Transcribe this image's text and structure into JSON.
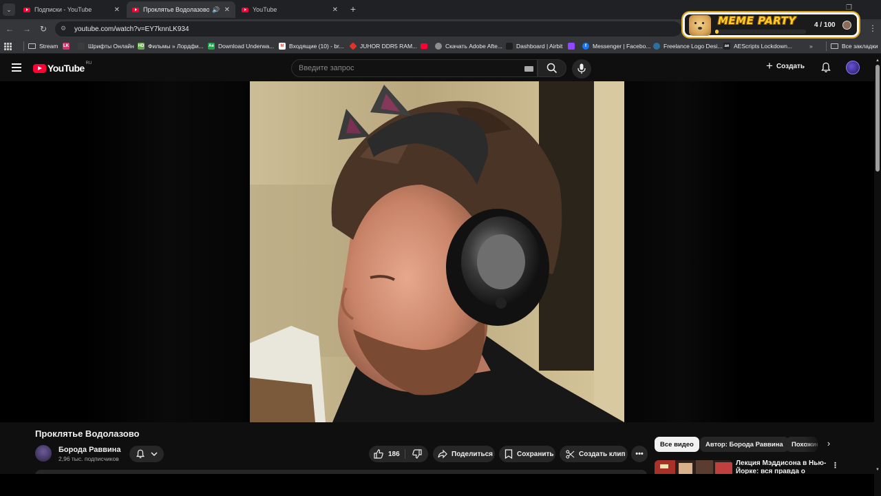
{
  "browser": {
    "tabs": [
      {
        "title": "Подписки - YouTube",
        "active": false
      },
      {
        "title": "Проклятье Водолазово - YouTube",
        "active": true
      },
      {
        "title": "YouTube",
        "active": false
      }
    ],
    "url": "youtube.com/watch?v=EY7knnLK934",
    "bookmarks": [
      {
        "label": "Stream",
        "icon": "folder-icon"
      },
      {
        "label": "",
        "icon": "lk-icon"
      },
      {
        "label": "Шрифты Онлайн",
        "icon": "blank-icon"
      },
      {
        "label": "Фильмы » Лордфи...",
        "icon": "hd-icon"
      },
      {
        "label": "Download Underwa...",
        "icon": "ae-icon"
      },
      {
        "label": "Входящие (10) - br...",
        "icon": "gmail-icon"
      },
      {
        "label": "JUHOR DDR5 RAM...",
        "icon": "aliexpress-icon"
      },
      {
        "label": "",
        "icon": "youtube-icon"
      },
      {
        "label": "Скачать Adobe Afte...",
        "icon": "globe-icon"
      },
      {
        "label": "Dashboard | Airbit",
        "icon": "airbit-icon"
      },
      {
        "label": "",
        "icon": "twitch-icon"
      },
      {
        "label": "Messenger | Facebo...",
        "icon": "facebook-icon"
      },
      {
        "label": "Freelance Logo Desi...",
        "icon": "gear-icon"
      },
      {
        "label": "AEScripts Lockdown...",
        "icon": "aescripts-icon"
      }
    ],
    "all_bookmarks": "Все закладки"
  },
  "extension": {
    "name": "MEME PARTY",
    "count": "4 / 100",
    "progress": 0.04
  },
  "youtube": {
    "region": "RU",
    "search_placeholder": "Введите запрос",
    "create_label": "Создать",
    "video": {
      "title": "Проклятье Водолазово",
      "channel": "Борода Раввина",
      "subscribers": "2,96 тыс. подписчиков",
      "likes": "186",
      "share": "Поделиться",
      "save": "Сохранить",
      "clip": "Создать клип"
    },
    "chips": [
      "Все видео",
      "Автор: Борода Раввина",
      "Похожие"
    ],
    "recommendation": {
      "title": "Лекция Мэддисона в Нью-Йорке: вся правда о стримах"
    }
  },
  "colors": {
    "accent": "#ff0033",
    "background": "#0f0f0f",
    "chip_selected": "#f1f1f1",
    "extension_gold": "#ffcb2e"
  }
}
